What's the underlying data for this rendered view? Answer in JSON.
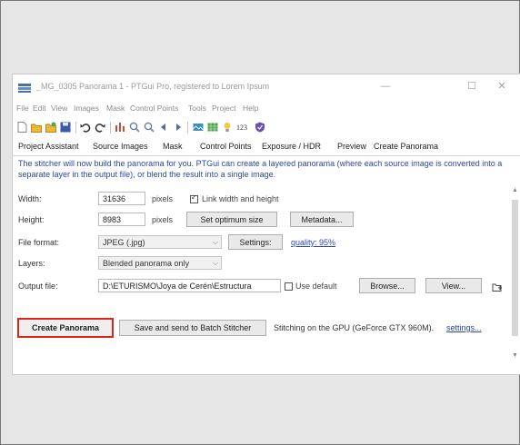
{
  "window": {
    "title": "_MG_0305 Panorama 1 - PTGui Pro, registered to Lorem Ipsum",
    "controls": [
      "—",
      "☐",
      "✕"
    ]
  },
  "menu": [
    "File",
    "Edit",
    "View",
    "Images",
    "Mask",
    "Control Points",
    "Tools",
    "Project",
    "Help"
  ],
  "toolbar": {
    "icons": [
      "new-icon",
      "open-icon",
      "open-recent-icon",
      "save-icon",
      "undo-icon",
      "redo-icon",
      "align-icon",
      "zoom-in-icon",
      "zoom-out-icon",
      "previous-icon",
      "next-icon",
      "panorama-editor-icon",
      "table-icon",
      "lightbulb-icon",
      "numbering-icon",
      "shield-icon"
    ],
    "numbering_label": "123"
  },
  "tabs": [
    "Project Assistant",
    "Source Images",
    "Mask",
    "Control Points",
    "Exposure / HDR",
    "Preview",
    "Create Panorama"
  ],
  "description": "The stitcher will now build the panorama for you. PTGui can create a layered panorama (where each source image is converted into a separate layer in the output file), or blend the result into a single image.",
  "form": {
    "width": {
      "label": "Width:",
      "value": "31636",
      "unit": "pixels"
    },
    "height": {
      "label": "Height:",
      "value": "8983",
      "unit": "pixels"
    },
    "link_label": "Link width and height",
    "optimum_label": "Set optimum size",
    "metadata_label": "Metadata...",
    "format": {
      "label": "File format:",
      "value": "JPEG (.jpg)",
      "settings_label": "Settings:",
      "quality": "quality: 95%"
    },
    "layers": {
      "label": "Layers:",
      "value": "Blended panorama only"
    },
    "output": {
      "label": "Output file:",
      "value": "D:\\ETURISMO\\Joya de Cerén\\Estructura",
      "use_default": "Use default",
      "browse": "Browse...",
      "view": "View..."
    }
  },
  "actions": {
    "create": "Create Panorama",
    "batch": "Save and send to Batch Stitcher",
    "status": "Stitching on the GPU (GeForce GTX 960M).",
    "settings_link": "settings..."
  },
  "colors": {
    "accent_link": "#2d46a8",
    "highlight_border": "#e0241b"
  }
}
